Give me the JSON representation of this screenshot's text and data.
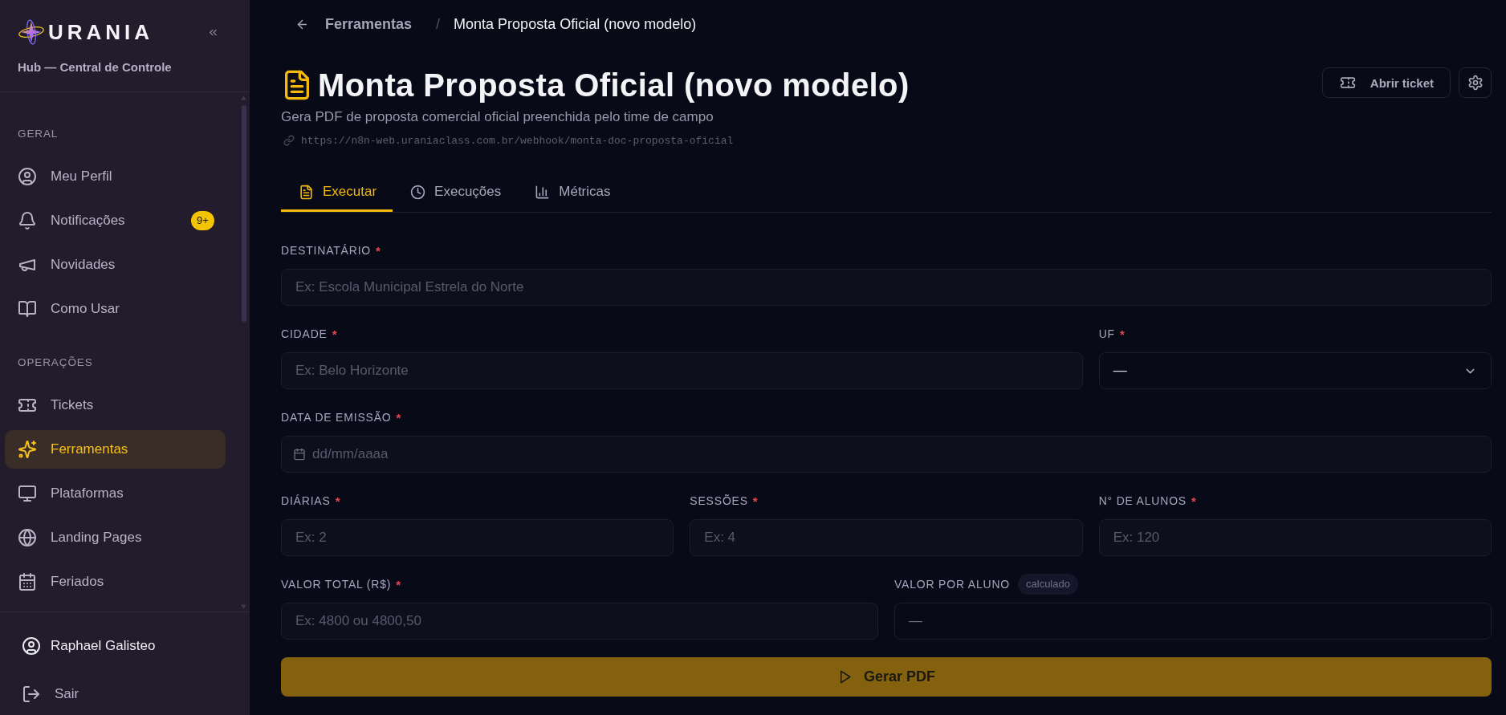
{
  "sidebar": {
    "brand": "URANIA",
    "subtitle": "Hub — Central de Controle",
    "sections": [
      {
        "title": "GERAL",
        "items": [
          {
            "label": "Meu Perfil",
            "selected": false
          },
          {
            "label": "Notificações",
            "badge": "9+",
            "selected": false
          },
          {
            "label": "Novidades",
            "selected": false
          },
          {
            "label": "Como Usar",
            "selected": false
          }
        ]
      },
      {
        "title": "OPERAÇÕES",
        "items": [
          {
            "label": "Tickets",
            "selected": false
          },
          {
            "label": "Ferramentas",
            "selected": true
          },
          {
            "label": "Plataformas",
            "selected": false
          },
          {
            "label": "Landing Pages",
            "selected": false
          },
          {
            "label": "Feriados",
            "selected": false
          }
        ]
      }
    ],
    "user": {
      "name": "Raphael Galisteo"
    },
    "logout": {
      "label": "Sair"
    }
  },
  "breadcrumb": {
    "parent": "Ferramentas",
    "separator": "/",
    "current": "Monta Proposta Oficial (novo modelo)"
  },
  "header": {
    "title": "Monta Proposta Oficial (novo modelo)",
    "description": "Gera PDF de proposta comercial oficial preenchida pelo time de campo",
    "url": "https://n8n-web.uraniaclass.com.br/webhook/monta-doc-proposta-oficial",
    "ticket_button": {
      "label": "Abrir ticket"
    }
  },
  "tabs": [
    {
      "label": "Executar",
      "selected": true
    },
    {
      "label": "Execuções",
      "selected": false
    },
    {
      "label": "Métricas",
      "selected": false
    }
  ],
  "form": {
    "fields": [
      {
        "kind": "text",
        "label": "DESTINATÁRIO",
        "required_mark": "*",
        "placeholder": "Ex: Escola Municipal Estrela do Norte"
      },
      {
        "kind": "text",
        "label": "CIDADE",
        "required_mark": "*",
        "placeholder": "Ex: Belo Horizonte"
      },
      {
        "kind": "select",
        "label": "UF",
        "required_mark": "*",
        "value": "—"
      },
      {
        "kind": "date",
        "label": "DATA DE EMISSÃO",
        "required_mark": "*",
        "placeholder": "dd/mm/aaaa"
      },
      {
        "kind": "text",
        "label": "DIÁRIAS",
        "required_mark": "*",
        "placeholder": "Ex: 2"
      },
      {
        "kind": "text",
        "label": "SESSÕES",
        "required_mark": "*",
        "placeholder": "Ex: 4"
      },
      {
        "kind": "text",
        "label": "N° DE ALUNOS",
        "required_mark": "*",
        "placeholder": "Ex: 120"
      },
      {
        "kind": "text",
        "label": "VALOR TOTAL (R$)",
        "required_mark": "*",
        "placeholder": "Ex: 4800 ou 4800,50"
      },
      {
        "kind": "readonly",
        "label": "VALOR POR ALUNO",
        "tag": "calculado",
        "value": "—"
      }
    ],
    "submit": {
      "label": "Gerar PDF"
    }
  }
}
